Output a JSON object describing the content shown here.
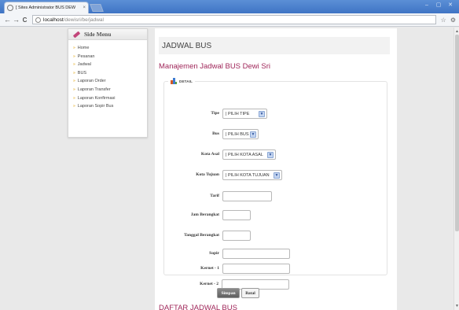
{
  "browser": {
    "tab_title": "[ Sites Administrator BUS DEW",
    "tab_close": "×",
    "window_buttons": [
      "–",
      "▢",
      "✕"
    ],
    "back": "←",
    "forward": "→",
    "reload": "C",
    "url_host": "localhost",
    "url_path": "/dewisri/be/jadwal",
    "star": "☆",
    "wrench": "⚙"
  },
  "sidemenu": {
    "title": "Side Menu",
    "items": [
      {
        "label": "Home"
      },
      {
        "label": "Pesanan"
      },
      {
        "label": "Jadwal"
      },
      {
        "label": "BUS"
      },
      {
        "label": "Laporan Order"
      },
      {
        "label": "Laporan Transfer"
      },
      {
        "label": "Laporan Konfirmasi"
      },
      {
        "label": "Laporan Sopir Bus"
      }
    ]
  },
  "main": {
    "page_title": "JADWAL BUS",
    "subtitle": "Manajemen Jadwal BUS Dewi Sri",
    "legend": "DETAIL",
    "fields": {
      "tipe": {
        "label": "Tipe",
        "value": "| PILIH TIPE"
      },
      "bus": {
        "label": "Bus",
        "value": "| PILIH BUS"
      },
      "kota_asal": {
        "label": "Kota Asal",
        "value": "| PILIH KOTA ASAL"
      },
      "kota_tujuan": {
        "label": "Kota Tujuan",
        "value": "| PILIH KOTA TUJUAN"
      },
      "tarif": {
        "label": "Tarif",
        "value": ""
      },
      "jam": {
        "label": "Jam Berangkat",
        "value": ""
      },
      "tanggal": {
        "label": "Tanggal Berangkat",
        "value": ""
      },
      "sopir": {
        "label": "Sopir",
        "value": ""
      },
      "kernet1": {
        "label": "Kernet - 1",
        "value": ""
      },
      "kernet2": {
        "label": "Kernet - 2",
        "value": ""
      }
    },
    "save_label": "Simpan",
    "cancel_label": "Batal",
    "list_title": "DAFTAR JADWAL BUS"
  },
  "icons": {
    "side_head": "pencil-icon",
    "bullet": "bullet-icon",
    "legend": "chart-icon",
    "select_arrow": "chevron-down-icon"
  },
  "colors": {
    "accent": "#a0275a",
    "bullet": "#e0a000",
    "titlebar": "#3f74c4"
  }
}
